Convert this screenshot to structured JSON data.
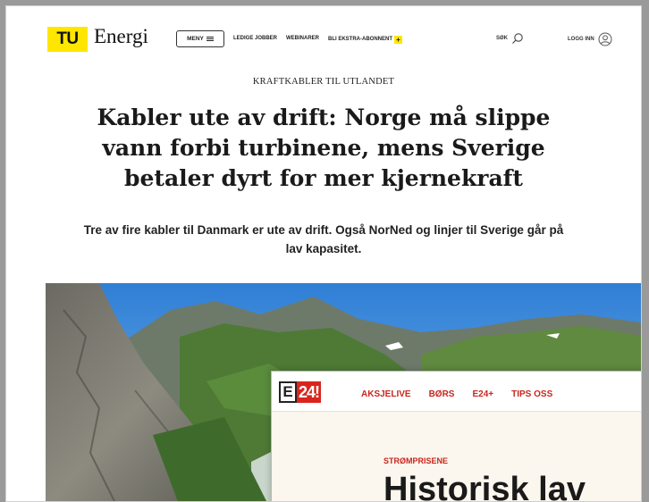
{
  "tu": {
    "logo_text": "TU",
    "site_name": "Energi",
    "menu_label": "MENY",
    "nav": [
      "LEDIGE JOBBER",
      "WEBINARER",
      "BLI EKSTRA-ABONNENT"
    ],
    "plus_icon": "+",
    "search_label": "SØK",
    "login_label": "LOGG INN",
    "brand_color": "#ffe600"
  },
  "article": {
    "kicker": "KRAFTKABLER TIL UTLANDET",
    "headline": "Kabler ute av drift: Norge må slippe vann forbi turbinene, mens Sverige betaler dyrt for mer kjernekraft",
    "lede": "Tre av fire kabler til Danmark er ute av drift. Også NorNed og linjer til Sverige går på lav kapasitet."
  },
  "e24": {
    "logo_e": "E",
    "logo_num": "24",
    "logo_excl": "!",
    "nav": [
      "AKSJELIVE",
      "BØRS",
      "E24+",
      "TIPS OSS"
    ],
    "kicker": "STRØMPRISENE",
    "headline": "Historisk lav",
    "accent_color": "#d8261e"
  }
}
